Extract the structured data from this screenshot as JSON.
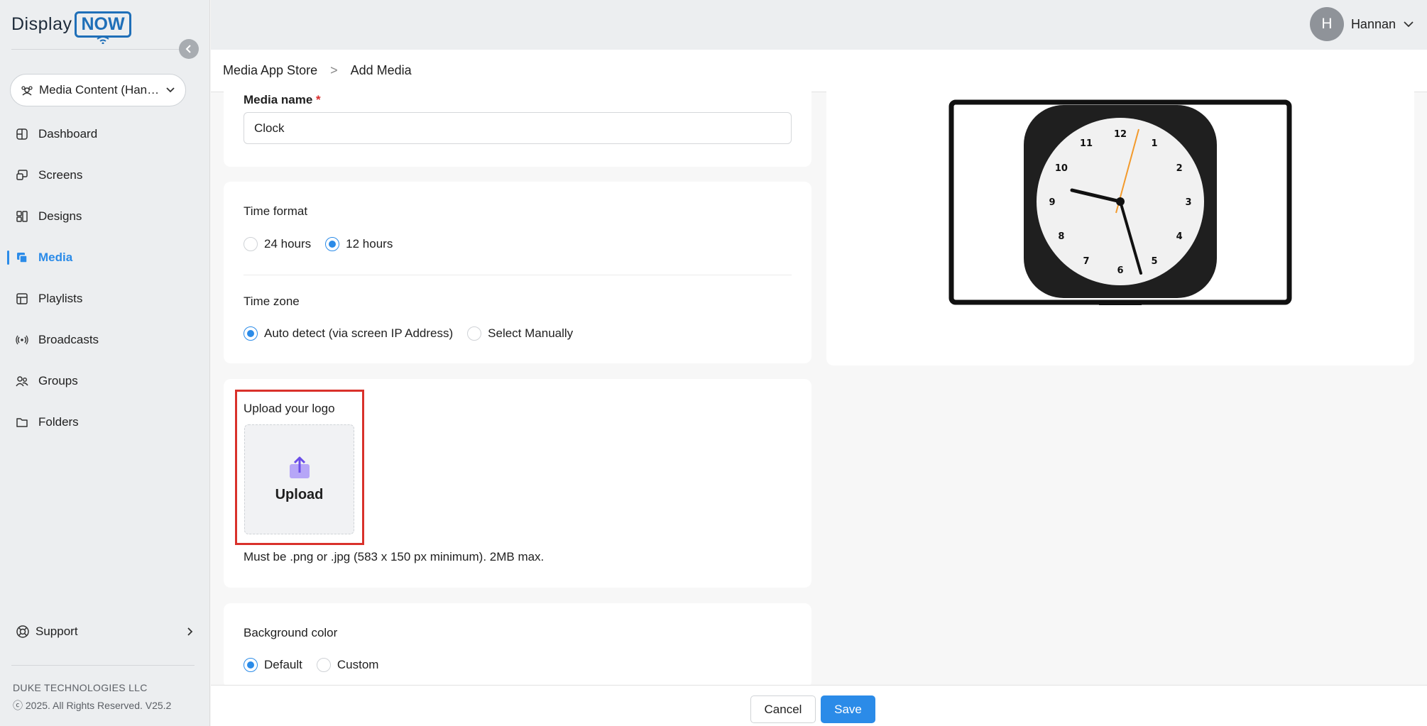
{
  "brand": {
    "display": "Display",
    "now": "NOW"
  },
  "sidebar": {
    "workspace_label": "Media Content (Han…",
    "items": [
      {
        "label": "Dashboard",
        "icon": "dashboard-icon"
      },
      {
        "label": "Screens",
        "icon": "screens-icon"
      },
      {
        "label": "Designs",
        "icon": "designs-icon"
      },
      {
        "label": "Media",
        "icon": "media-icon",
        "active": true
      },
      {
        "label": "Playlists",
        "icon": "playlists-icon"
      },
      {
        "label": "Broadcasts",
        "icon": "broadcast-icon"
      },
      {
        "label": "Groups",
        "icon": "groups-icon"
      },
      {
        "label": "Folders",
        "icon": "folder-icon"
      }
    ],
    "support_label": "Support",
    "company": "DUKE TECHNOLOGIES LLC",
    "copyright": "ⓒ 2025. All Rights Reserved. V25.2"
  },
  "user": {
    "initial": "H",
    "name": "Hannan"
  },
  "breadcrumb": {
    "parent": "Media App Store",
    "separator": ">",
    "current": "Add Media"
  },
  "form": {
    "media_name_label": "Media name",
    "required_mark": "*",
    "media_name_value": "Clock",
    "time_format_label": "Time format",
    "time_format_options": [
      "24 hours",
      "12 hours"
    ],
    "time_format_selected": "12 hours",
    "time_zone_label": "Time zone",
    "time_zone_options": [
      "Auto detect (via screen IP Address)",
      "Select Manually"
    ],
    "time_zone_selected": "Auto detect (via screen IP Address)",
    "logo_label": "Upload your logo",
    "upload_label": "Upload",
    "upload_hint": "Must be .png or .jpg (583 x 150 px minimum). 2MB max.",
    "bg_color_label": "Background color",
    "bg_color_options": [
      "Default",
      "Custom"
    ],
    "bg_color_selected": "Default"
  },
  "preview": {
    "clock_numbers": [
      "12",
      "1",
      "2",
      "3",
      "4",
      "5",
      "6",
      "7",
      "8",
      "9",
      "10",
      "11"
    ]
  },
  "actions": {
    "cancel_label": "Cancel",
    "save_label": "Save"
  },
  "colors": {
    "accent": "#2b8be8",
    "highlight": "#d9312b",
    "upload_icon": "#8b6cf0",
    "second_hand": "#f39a2b"
  }
}
